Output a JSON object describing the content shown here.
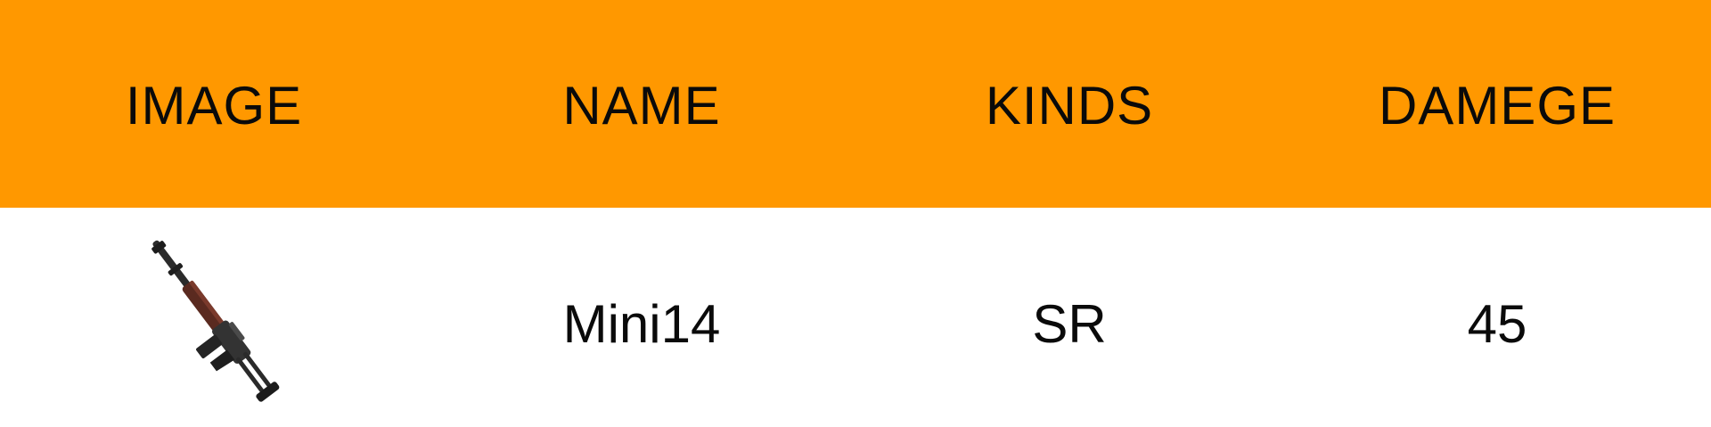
{
  "table": {
    "header_color": "#FF9800",
    "columns": [
      "IMAGE",
      "NAME",
      "KINDS",
      "DAMEGE"
    ],
    "rows": [
      {
        "image_icon": "rifle-icon",
        "name": "Mini14",
        "kind": "SR",
        "damage": "45"
      }
    ]
  }
}
